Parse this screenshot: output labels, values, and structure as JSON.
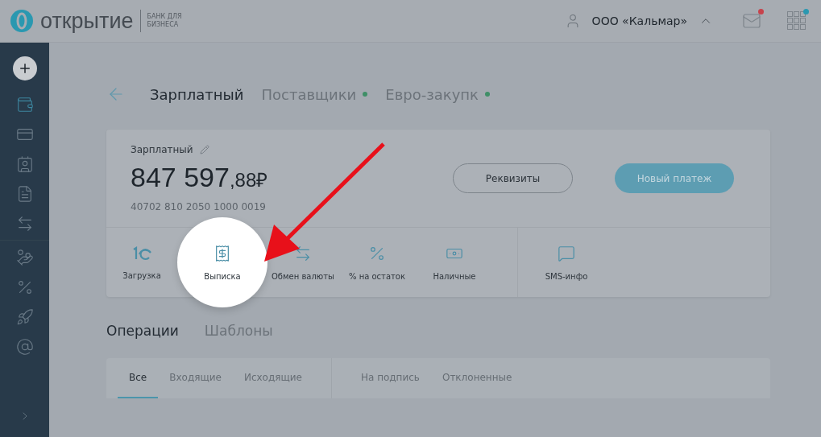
{
  "header": {
    "logo": "открытие",
    "logo_sub": "БАНК ДЛЯ БИЗНЕСА",
    "company": "ООО «Кальмар»",
    "mail_unread": true,
    "apps_badge": true
  },
  "sidebar": {
    "items": [
      {
        "kind": "wallet",
        "selected": true
      },
      {
        "kind": "card",
        "selected": false
      },
      {
        "kind": "contact",
        "selected": false
      },
      {
        "kind": "document",
        "selected": false
      },
      {
        "kind": "exchange",
        "selected": false
      },
      {
        "kind": "moneybag",
        "selected": false
      },
      {
        "kind": "percent",
        "selected": false
      },
      {
        "kind": "rocket",
        "selected": false
      },
      {
        "kind": "at",
        "selected": false
      }
    ]
  },
  "account_tabs": [
    {
      "label": "Зарплатный",
      "selected": true,
      "dot": false
    },
    {
      "label": "Поставщики",
      "selected": false,
      "dot": true
    },
    {
      "label": "Евро-закупк",
      "selected": false,
      "dot": true
    }
  ],
  "account": {
    "name": "Зарплатный",
    "balance": "847 597",
    "cents": ",88₽",
    "number": "40702 810 2050 1000 0019"
  },
  "buttons": [
    {
      "label": "Реквизиты",
      "kind": "outline"
    },
    {
      "label": "Новый платеж",
      "kind": "primary"
    }
  ],
  "actions": [
    {
      "label": "Загрузка",
      "highlighted": false
    },
    {
      "label": "Выписка",
      "highlighted": true
    },
    {
      "label": "Обмен валюты",
      "highlighted": false
    },
    {
      "label": "% на остаток",
      "highlighted": false
    },
    {
      "label": "Наличные",
      "highlighted": false
    },
    {
      "label": "SMS-инфо",
      "highlighted": false
    }
  ],
  "section_tabs": [
    {
      "label": "Операции",
      "selected": true
    },
    {
      "label": "Шаблоны",
      "selected": false
    }
  ],
  "filter_groups": [
    [
      {
        "label": "Все",
        "selected": true
      },
      {
        "label": "Входящие",
        "selected": false
      },
      {
        "label": "Исходящие",
        "selected": false
      }
    ],
    [
      {
        "label": "На подпись",
        "selected": false
      },
      {
        "label": "Отклоненные",
        "selected": false
      }
    ]
  ]
}
